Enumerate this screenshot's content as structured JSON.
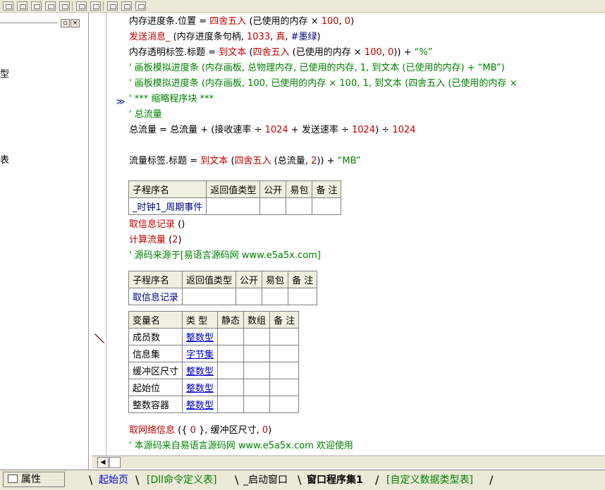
{
  "side_panel": {
    "close_glyph": "×",
    "min_glyph": "▫",
    "text_1": "型",
    "text_2": "表"
  },
  "code_lines": [
    {
      "segments": [
        {
          "t": "内存进度条.位置 ",
          "c": "blk"
        },
        {
          "t": "= ",
          "c": "blk"
        },
        {
          "t": "四舍五入",
          "c": "red"
        },
        {
          "t": " (已使用的内存 × ",
          "c": "blk"
        },
        {
          "t": "100",
          "c": "red"
        },
        {
          "t": ", ",
          "c": "blk"
        },
        {
          "t": "0",
          "c": "red"
        },
        {
          "t": ")",
          "c": "blk"
        }
      ]
    },
    {
      "segments": [
        {
          "t": "发送消息_",
          "c": "red"
        },
        {
          "t": " (内存进度条句柄, ",
          "c": "blk"
        },
        {
          "t": "1033",
          "c": "red"
        },
        {
          "t": ", ",
          "c": "blk"
        },
        {
          "t": "真",
          "c": "red"
        },
        {
          "t": ", ",
          "c": "blk"
        },
        {
          "t": "#墨绿",
          "c": "navy"
        },
        {
          "t": ")",
          "c": "blk"
        }
      ]
    },
    {
      "segments": [
        {
          "t": "内存透明标签.标题 ",
          "c": "blk"
        },
        {
          "t": "= ",
          "c": "blk"
        },
        {
          "t": "到文本",
          "c": "red"
        },
        {
          "t": " (",
          "c": "blk"
        },
        {
          "t": "四舍五入",
          "c": "red"
        },
        {
          "t": " (已使用的内存 × ",
          "c": "blk"
        },
        {
          "t": "100",
          "c": "red"
        },
        {
          "t": ", ",
          "c": "blk"
        },
        {
          "t": "0",
          "c": "red"
        },
        {
          "t": ")) + ",
          "c": "blk"
        },
        {
          "t": "“%”",
          "c": "grn"
        }
      ]
    },
    {
      "segments": [
        {
          "t": "' 画板模拟进度条 (内存画板, 总物理内存, 已使用的内存, 1, 到文本 (已使用的内存) + “MB”)",
          "c": "grn"
        }
      ]
    },
    {
      "segments": [
        {
          "t": "' 画板模拟进度条 (内存画板, 100, 已使用的内存 × 100, 1, 到文本 (四舍五入 (已使用的内存 ×",
          "c": "grn"
        }
      ]
    },
    {
      "segments": [
        {
          "t": "' *** 缩略程序块 ***",
          "c": "grn"
        }
      ]
    },
    {
      "segments": [
        {
          "t": "' 总流量",
          "c": "grn"
        }
      ]
    },
    {
      "segments": [
        {
          "t": "总流量 ",
          "c": "blk"
        },
        {
          "t": "= ",
          "c": "blk"
        },
        {
          "t": "总流量 + (接收速率 ÷ ",
          "c": "blk"
        },
        {
          "t": "1024",
          "c": "red"
        },
        {
          "t": " + 发送速率 ÷ ",
          "c": "blk"
        },
        {
          "t": "1024",
          "c": "red"
        },
        {
          "t": ") ÷ ",
          "c": "blk"
        },
        {
          "t": "1024",
          "c": "red"
        }
      ]
    },
    {
      "segments": []
    },
    {
      "segments": [
        {
          "t": "流量标签.标题 ",
          "c": "blk"
        },
        {
          "t": "= ",
          "c": "blk"
        },
        {
          "t": "到文本",
          "c": "red"
        },
        {
          "t": " (",
          "c": "blk"
        },
        {
          "t": "四舍五入",
          "c": "red"
        },
        {
          "t": " (总流量, ",
          "c": "blk"
        },
        {
          "t": "2",
          "c": "red"
        },
        {
          "t": ")) + ",
          "c": "blk"
        },
        {
          "t": "“MB”",
          "c": "grn"
        }
      ]
    }
  ],
  "sub_table_1": {
    "headers": [
      "子程序名",
      "返回值类型",
      "公开",
      "易包",
      "备 注"
    ],
    "row": [
      "_时钟1_周期事件",
      "",
      "",
      "",
      ""
    ]
  },
  "mid_lines": [
    {
      "segments": [
        {
          "t": "取信息记录",
          "c": "red"
        },
        {
          "t": " ()",
          "c": "blk"
        }
      ]
    },
    {
      "segments": [
        {
          "t": "计算流量",
          "c": "red"
        },
        {
          "t": " (",
          "c": "blk"
        },
        {
          "t": "2",
          "c": "red"
        },
        {
          "t": ")",
          "c": "blk"
        }
      ]
    },
    {
      "segments": [
        {
          "t": "' 源码来源于[易语言源码网 www.e5a5x.com]",
          "c": "grn"
        }
      ]
    }
  ],
  "sub_table_2": {
    "headers": [
      "子程序名",
      "返回值类型",
      "公开",
      "易包",
      "备 注"
    ],
    "row": [
      "取信息记录",
      "",
      "",
      "",
      ""
    ]
  },
  "var_table": {
    "headers": [
      "变量名",
      "类 型",
      "静态",
      "数组",
      "备 注"
    ],
    "rows": [
      [
        "成员数",
        "整数型"
      ],
      [
        "信息集",
        "字节集"
      ],
      [
        "缓冲区尺寸",
        "整数型"
      ],
      [
        "起始位",
        "整数型"
      ],
      [
        "整数容器",
        "整数型"
      ]
    ]
  },
  "bottom_lines": [
    {
      "segments": [
        {
          "t": "取网络信息",
          "c": "red"
        },
        {
          "t": " ({ ",
          "c": "blk"
        },
        {
          "t": "0",
          "c": "red"
        },
        {
          "t": " }, 缓冲区尺寸, ",
          "c": "blk"
        },
        {
          "t": "0",
          "c": "red"
        },
        {
          "t": ")",
          "c": "blk"
        }
      ]
    },
    {
      "segments": [
        {
          "t": "' 本源码来自易语言源码网 www.e5a5x.com  欢迎使用",
          "c": "grn"
        }
      ]
    }
  ],
  "fold_marker": "≫",
  "scroll_left_glyph": "◀",
  "tabs": {
    "properties": "属性",
    "items": [
      "起始页",
      "[Dll命令定义表]",
      "_启动窗口",
      "窗口程序集1",
      "[自定义数据类型表]"
    ]
  }
}
